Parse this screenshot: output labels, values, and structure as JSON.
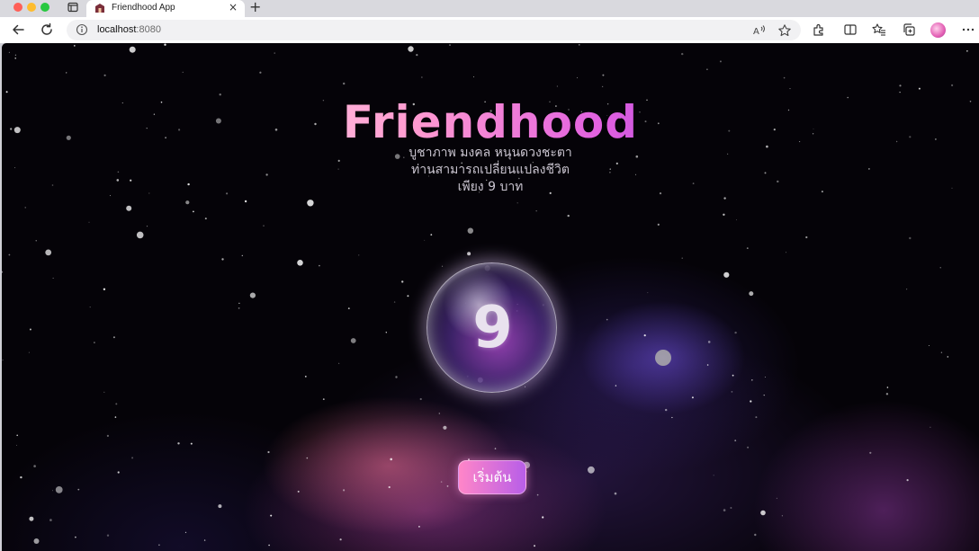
{
  "browser": {
    "tab_title": "Friendhood App",
    "url_host": "localhost",
    "url_port": ":8080"
  },
  "page": {
    "title": "Friendhood",
    "subtitle_lines": [
      "บูชาภาพ มงคล หนุนดวงชะตา",
      "ท่านสามารถเปลี่ยนแปลงชีวิต",
      "เพียง 9 บาท"
    ],
    "orb_number": "9",
    "start_button_label": "เริ่มต้น"
  },
  "theme": {
    "title_gradient": [
      "#fff4f8",
      "#ff9bd0",
      "#e05fe0",
      "#3b2fb0"
    ],
    "button_gradient": [
      "#ff86c8",
      "#b85ee8"
    ],
    "background": "#050308"
  }
}
